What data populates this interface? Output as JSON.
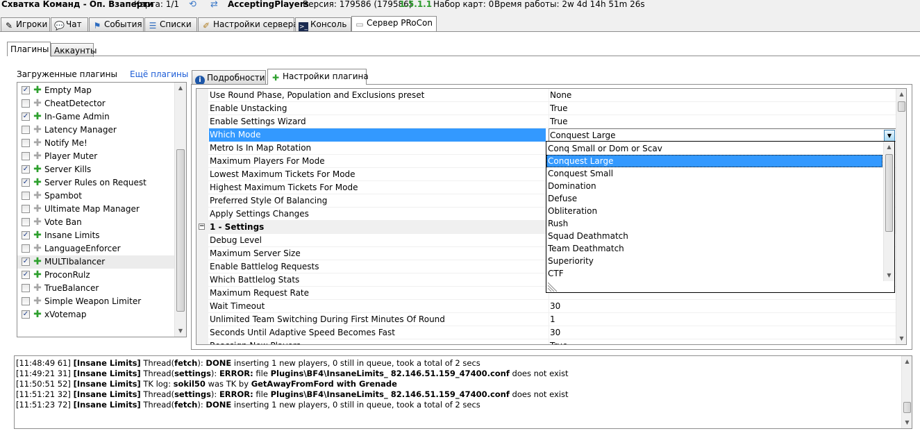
{
  "status_bar": {
    "server_name": "Схватка Команд - Оп. Взаперти",
    "map": "Карта: 1/1",
    "state": "AcceptingPlayers",
    "version": "Версия: 179586 (179586)",
    "procon_version": "1.5.1.1",
    "map_set": "Набор карт: 0",
    "uptime": "Время работы: 2w 4d 14h 51m 26s"
  },
  "main_tabs": [
    {
      "label": "Игроки",
      "icon": "pencil-icon"
    },
    {
      "label": "Чат",
      "icon": "chat-icon"
    },
    {
      "label": "События",
      "icon": "events-icon"
    },
    {
      "label": "Списки",
      "icon": "list-icon"
    },
    {
      "label": "Настройки сервера",
      "icon": "server-settings-icon"
    },
    {
      "label": "Консоль",
      "icon": "console-icon"
    },
    {
      "label": "Сервер PRoCon",
      "icon": "procon-server-icon",
      "active": true
    }
  ],
  "sub_tabs": [
    {
      "label": "Плагины",
      "active": true
    },
    {
      "label": "Аккаунты"
    }
  ],
  "plugins_panel": {
    "loaded_label": "Загруженные плагины",
    "more_link": "Ещё плагины",
    "items": [
      {
        "label": "Empty Map",
        "checked": true
      },
      {
        "label": "CheatDetector",
        "checked": false
      },
      {
        "label": "In-Game Admin",
        "checked": true
      },
      {
        "label": "Latency Manager",
        "checked": false
      },
      {
        "label": "Notify Me!",
        "checked": false
      },
      {
        "label": "Player Muter",
        "checked": false
      },
      {
        "label": "Server Kills",
        "checked": true
      },
      {
        "label": "Server Rules on Request",
        "checked": true
      },
      {
        "label": "Spambot",
        "checked": false
      },
      {
        "label": "Ultimate Map Manager",
        "checked": false
      },
      {
        "label": "Vote Ban",
        "checked": false
      },
      {
        "label": "Insane Limits",
        "checked": true
      },
      {
        "label": "LanguageEnforcer",
        "checked": false
      },
      {
        "label": "MULTIbalancer",
        "checked": true,
        "selected": true
      },
      {
        "label": "ProconRulz",
        "checked": true
      },
      {
        "label": "TrueBalancer",
        "checked": false
      },
      {
        "label": "Simple Weapon Limiter",
        "checked": false
      },
      {
        "label": "xVotemap",
        "checked": true
      }
    ]
  },
  "detail_tabs": [
    {
      "label": "Подробности",
      "icon": "info-icon"
    },
    {
      "label": "Настройки плагина",
      "icon": "puzzle-icon",
      "active": true
    }
  ],
  "property_grid": {
    "rows": [
      {
        "name": "Use Round Phase, Population and Exclusions preset",
        "value": "None"
      },
      {
        "name": "Enable Unstacking",
        "value": "True"
      },
      {
        "name": "Enable Settings Wizard",
        "value": "True"
      },
      {
        "name": "Which Mode",
        "value": "Conquest Large",
        "selected": true,
        "dropdown": true
      },
      {
        "name": "Metro Is In Map Rotation",
        "value": ""
      },
      {
        "name": "Maximum Players For Mode",
        "value": ""
      },
      {
        "name": "Lowest Maximum Tickets For Mode",
        "value": ""
      },
      {
        "name": "Highest Maximum Tickets For Mode",
        "value": ""
      },
      {
        "name": "Preferred Style Of Balancing",
        "value": ""
      },
      {
        "name": "Apply Settings Changes",
        "value": ""
      },
      {
        "name": "1 - Settings",
        "value": "",
        "category": true
      },
      {
        "name": "Debug Level",
        "value": ""
      },
      {
        "name": "Maximum Server Size",
        "value": ""
      },
      {
        "name": "Enable Battlelog Requests",
        "value": ""
      },
      {
        "name": "Which Battlelog Stats",
        "value": ""
      },
      {
        "name": "Maximum Request Rate",
        "value": ""
      },
      {
        "name": "Wait Timeout",
        "value": "30"
      },
      {
        "name": "Unlimited Team Switching During First Minutes Of Round",
        "value": "1"
      },
      {
        "name": "Seconds Until Adaptive Speed Becomes Fast",
        "value": "30"
      },
      {
        "name": "Reassign New Players",
        "value": "True"
      }
    ]
  },
  "mode_dropdown": {
    "options": [
      "Conq Small or Dom or Scav",
      "Conquest Large",
      "Conquest Small",
      "Domination",
      "Defuse",
      "Obliteration",
      "Rush",
      "Squad Deathmatch",
      "Team Deathmatch",
      "Superiority",
      "CTF"
    ],
    "selected_index": 1
  },
  "log": {
    "lines": [
      {
        "time": "[11:48:49 61]",
        "src": "[Insane Limits]",
        "parts": [
          [
            "n",
            "Thread("
          ],
          [
            "b",
            "fetch"
          ],
          [
            "n",
            "): "
          ],
          [
            "b",
            "DONE"
          ],
          [
            "n",
            " inserting 1 new players, 0 still in queue, took a total of 2 secs"
          ]
        ]
      },
      {
        "time": "[11:49:21 31]",
        "src": "[Insane Limits]",
        "parts": [
          [
            "n",
            "Thread("
          ],
          [
            "b",
            "settings"
          ],
          [
            "n",
            "): "
          ],
          [
            "b",
            "ERROR:"
          ],
          [
            "n",
            " file "
          ],
          [
            "b",
            "Plugins\\BF4\\InsaneLimits_ 82.146.51.159_47400.conf"
          ],
          [
            "n",
            " does not exist"
          ]
        ]
      },
      {
        "time": "[11:50:51 52]",
        "src": "[Insane Limits]",
        "parts": [
          [
            "n",
            "TK log: "
          ],
          [
            "b",
            "sokil50"
          ],
          [
            "n",
            " was TK by "
          ],
          [
            "b",
            "GetAwayFromFord with Grenade"
          ]
        ]
      },
      {
        "time": "[11:51:21 32]",
        "src": "[Insane Limits]",
        "parts": [
          [
            "n",
            "Thread("
          ],
          [
            "b",
            "settings"
          ],
          [
            "n",
            "): "
          ],
          [
            "b",
            "ERROR:"
          ],
          [
            "n",
            " file "
          ],
          [
            "b",
            "Plugins\\BF4\\InsaneLimits_ 82.146.51.159_47400.conf"
          ],
          [
            "n",
            " does not exist"
          ]
        ]
      },
      {
        "time": "[11:51:23 72]",
        "src": "[Insane Limits]",
        "parts": [
          [
            "n",
            "Thread("
          ],
          [
            "b",
            "fetch"
          ],
          [
            "n",
            "): "
          ],
          [
            "b",
            "DONE"
          ],
          [
            "n",
            " inserting 1 new players, 0 still in queue, took a total of 2 secs"
          ]
        ]
      }
    ]
  }
}
